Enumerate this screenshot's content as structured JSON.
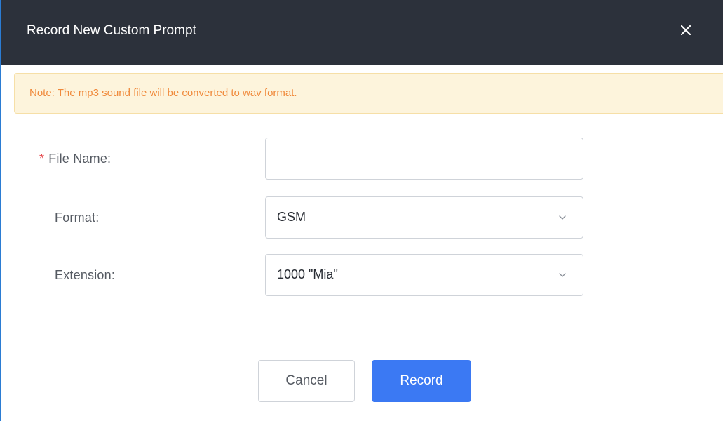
{
  "dialog": {
    "title": "Record New Custom Prompt",
    "close_icon": "close-icon",
    "note": "Note: The mp3 sound file will be converted to wav format."
  },
  "form": {
    "file_name": {
      "required_mark": "*",
      "label": "File Name:",
      "value": ""
    },
    "format": {
      "label": "Format:",
      "value": "GSM"
    },
    "extension": {
      "label": "Extension:",
      "value": "1000 \"Mia\""
    }
  },
  "buttons": {
    "cancel": "Cancel",
    "record": "Record"
  },
  "colors": {
    "titlebar_bg": "#2c313b",
    "note_bg": "#fdf4dc",
    "note_text": "#f08a3c",
    "required": "#e5484d",
    "primary": "#3b79f3"
  }
}
